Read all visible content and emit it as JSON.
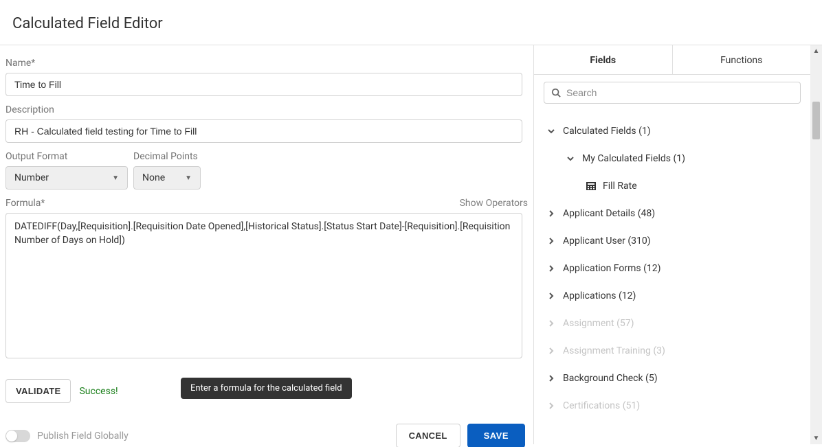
{
  "header": {
    "title": "Calculated Field Editor"
  },
  "form": {
    "name_label": "Name*",
    "name_value": "Time to Fill",
    "desc_label": "Description",
    "desc_value": "RH - Calculated field testing for Time to Fill",
    "output_label": "Output Format",
    "output_value": "Number",
    "decimal_label": "Decimal Points",
    "decimal_value": "None",
    "formula_label": "Formula*",
    "show_operators": "Show Operators",
    "formula_value": "DATEDIFF(Day,[Requisition].[Requisition Date Opened],[Historical Status].[Status Start Date]-[Requisition].[Requisition Number of Days on Hold])"
  },
  "validate": {
    "button": "VALIDATE",
    "status": "Success!",
    "tooltip": "Enter a formula for the calculated field"
  },
  "footer": {
    "toggle_label": "Publish Field Globally",
    "cancel": "CANCEL",
    "save": "SAVE"
  },
  "sidebar": {
    "tab_fields": "Fields",
    "tab_functions": "Functions",
    "search_placeholder": "Search",
    "tree": [
      {
        "label": "Calculated Fields (1)",
        "level": 0,
        "expanded": true,
        "disabled": false,
        "icon": "chev-down",
        "leaf": false
      },
      {
        "label": "My Calculated Fields (1)",
        "level": 1,
        "expanded": true,
        "disabled": false,
        "icon": "chev-down",
        "leaf": false
      },
      {
        "label": "Fill Rate",
        "level": 2,
        "expanded": false,
        "disabled": false,
        "icon": "calc",
        "leaf": true
      },
      {
        "label": "Applicant Details (48)",
        "level": 0,
        "expanded": false,
        "disabled": false,
        "icon": "chev-right",
        "leaf": false
      },
      {
        "label": "Applicant User (310)",
        "level": 0,
        "expanded": false,
        "disabled": false,
        "icon": "chev-right",
        "leaf": false
      },
      {
        "label": "Application Forms (12)",
        "level": 0,
        "expanded": false,
        "disabled": false,
        "icon": "chev-right",
        "leaf": false
      },
      {
        "label": "Applications (12)",
        "level": 0,
        "expanded": false,
        "disabled": false,
        "icon": "chev-right",
        "leaf": false
      },
      {
        "label": "Assignment (57)",
        "level": 0,
        "expanded": false,
        "disabled": true,
        "icon": "chev-right",
        "leaf": false
      },
      {
        "label": "Assignment Training (3)",
        "level": 0,
        "expanded": false,
        "disabled": true,
        "icon": "chev-right",
        "leaf": false
      },
      {
        "label": "Background Check (5)",
        "level": 0,
        "expanded": false,
        "disabled": false,
        "icon": "chev-right",
        "leaf": false
      },
      {
        "label": "Certifications (51)",
        "level": 0,
        "expanded": false,
        "disabled": true,
        "icon": "chev-right",
        "leaf": false
      }
    ]
  }
}
